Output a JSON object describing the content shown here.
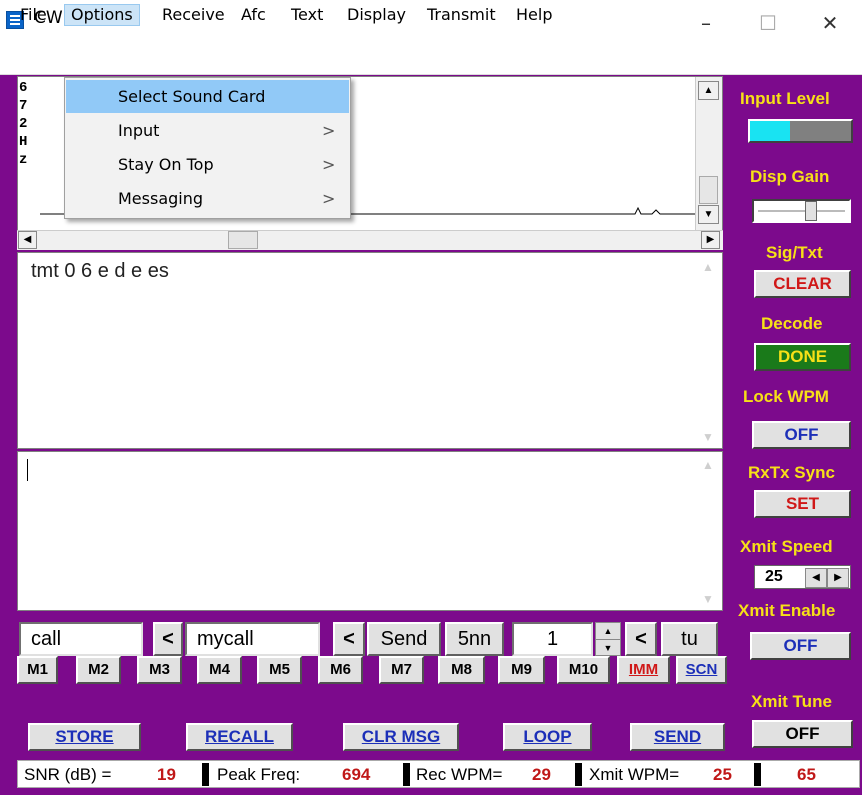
{
  "window": {
    "title": "CW Decoder",
    "minimize": "–",
    "maximize": "☐",
    "close": "✕"
  },
  "menubar": [
    "File",
    "Options",
    "Receive",
    "Afc",
    "Text",
    "Display",
    "Transmit",
    "Help"
  ],
  "options_menu": {
    "items": [
      {
        "label": "Select Sound Card",
        "arrow": ""
      },
      {
        "label": "Input",
        "arrow": ">"
      },
      {
        "label": "Stay On Top",
        "arrow": ">"
      },
      {
        "label": "Messaging",
        "arrow": ">"
      }
    ]
  },
  "signal": {
    "freq_label": [
      "6",
      "7",
      "2",
      "H",
      "z"
    ]
  },
  "receive": {
    "text": "tmt 0 6 e d e es"
  },
  "transmit": {
    "text": ""
  },
  "controls": {
    "call_value": "call",
    "back1": "<",
    "mycall_value": "mycall",
    "back2": "<",
    "send": "Send",
    "fivenn": "5nn",
    "counter_value": "1",
    "back3": "<",
    "tu": "tu"
  },
  "memory_buttons": [
    "M1",
    "M2",
    "M3",
    "M4",
    "M5",
    "M6",
    "M7",
    "M8",
    "M9",
    "M10"
  ],
  "imm": "IMM",
  "scn": "SCN",
  "actions": [
    "STORE",
    "RECALL",
    "CLR MSG",
    "LOOP",
    "SEND"
  ],
  "status": {
    "snr_label": "SNR (dB) =",
    "snr_value": "19",
    "peak_label": "Peak Freq:",
    "peak_value": "694",
    "rec_label": "Rec WPM=",
    "rec_value": "29",
    "xmit_label": "Xmit WPM=",
    "xmit_value": "25",
    "extra_value": "65"
  },
  "right_panel": {
    "input_level_label": "Input Level",
    "input_level": 0.4,
    "disp_gain_label": "Disp Gain",
    "disp_gain": 0.6,
    "sig_txt_label": "Sig/Txt",
    "sig_txt_button": "CLEAR",
    "decode_label": "Decode",
    "decode_button": "DONE",
    "lock_wpm_label": "Lock WPM",
    "lock_wpm_button": "OFF",
    "rxtx_sync_label": "RxTx Sync",
    "rxtx_sync_button": "SET",
    "xmit_speed_label": "Xmit Speed",
    "xmit_speed_value": "25",
    "xmit_enable_label": "Xmit Enable",
    "xmit_enable_button": "OFF",
    "xmit_tune_label": "Xmit Tune",
    "xmit_tune_button": "OFF"
  },
  "colors": {
    "panel_bg": "#7c0a8c",
    "label_yellow": "#f7e017",
    "clear_red": "#d01818",
    "done_bg": "#1a7a1a",
    "off_blue": "#1c2fb8",
    "level_cyan": "#19e3f2"
  }
}
